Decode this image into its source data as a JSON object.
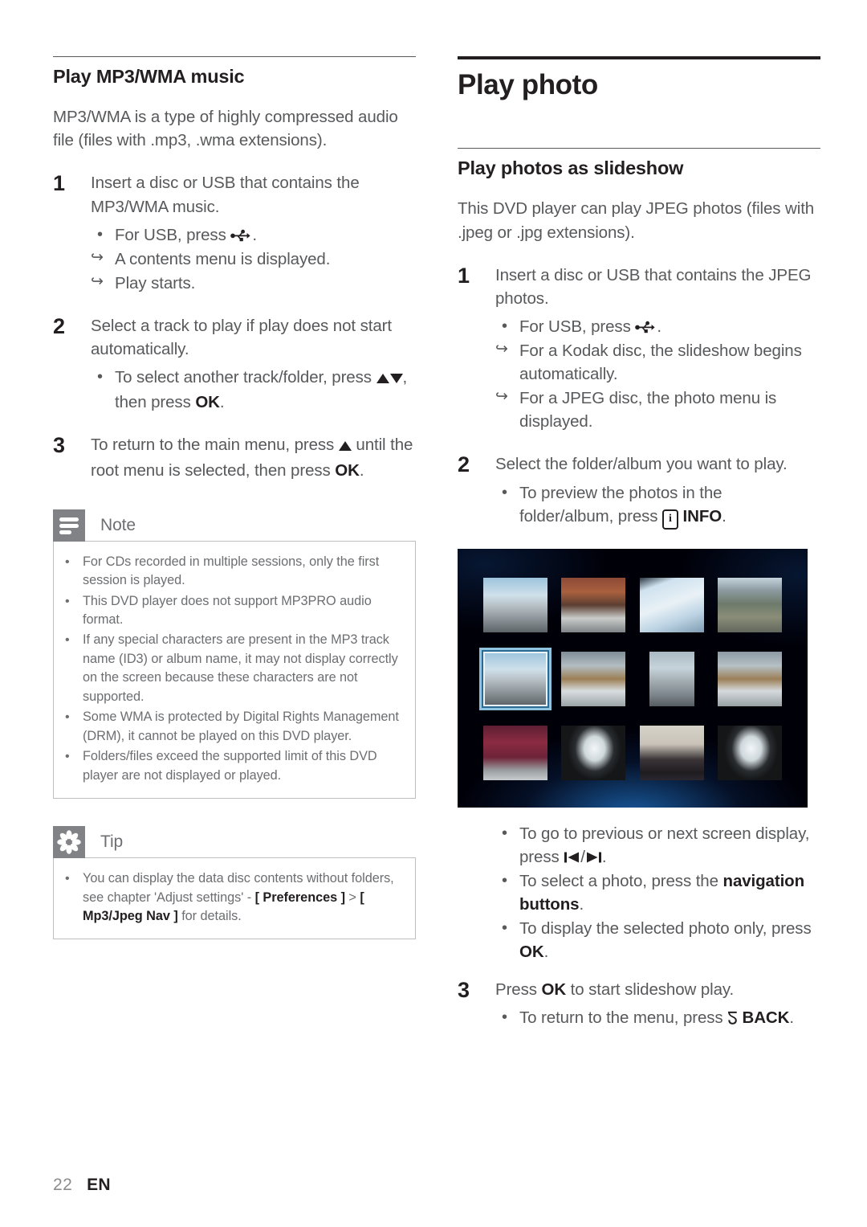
{
  "page": {
    "number": "22",
    "language": "EN"
  },
  "left_column": {
    "section_title": "Play MP3/WMA music",
    "intro": "MP3/WMA is a type of highly compressed audio file (files with .mp3, .wma extensions).",
    "steps": [
      {
        "number": "1",
        "text": "Insert a disc or USB that contains the MP3/WMA music.",
        "sub": [
          {
            "mark": "bullet",
            "text_before": "For USB, press ",
            "icon": "usb-icon",
            "text_after": "."
          },
          {
            "mark": "arrow",
            "text_before": "A contents menu is displayed.",
            "icon": "",
            "text_after": ""
          },
          {
            "mark": "arrow",
            "text_before": "Play starts.",
            "icon": "",
            "text_after": ""
          }
        ]
      },
      {
        "number": "2",
        "text": "Select a track to play if play does not start automatically.",
        "sub": [
          {
            "mark": "bullet",
            "text_before": "To select another track/folder, press ",
            "icon": "up-down-arrows-icon",
            "text_after": ",  then press ",
            "bold_after": "OK",
            "text_end": "."
          }
        ]
      },
      {
        "number": "3",
        "text_parts": {
          "a": "To return to the main menu, press ",
          "icon": "up-arrow-icon",
          "b": " until the root menu is selected, then press ",
          "bold": "OK",
          "c": "."
        }
      }
    ],
    "note": {
      "title": "Note",
      "icon": "note-lines-icon",
      "items": [
        "For CDs recorded in multiple sessions, only the first session is played.",
        "This DVD player does not support MP3PRO audio format.",
        "If any special characters are present in the MP3 track name (ID3) or album name, it may not display correctly on the screen because these characters are not supported.",
        "Some WMA is protected by Digital Rights Management (DRM), it cannot be played on this DVD player.",
        "Folders/files exceed the supported limit of this DVD player are not displayed or played."
      ]
    },
    "tip": {
      "title": "Tip",
      "icon": "tip-asterisk-icon",
      "item": {
        "part1": "You can display the data disc contents without folders, see chapter 'Adjust settings' - ",
        "bold1": "[ Preferences ]",
        "part2": " > ",
        "bold2": "[ Mp3/Jpeg Nav ]",
        "part3": " for details."
      }
    }
  },
  "right_column": {
    "chapter_title": "Play photo",
    "section_title": "Play photos as slideshow",
    "intro": "This DVD player can play JPEG photos (files with .jpeg or .jpg extensions).",
    "steps": [
      {
        "number": "1",
        "text": "Insert a disc or USB that contains the JPEG photos.",
        "sub": [
          {
            "mark": "bullet",
            "text_before": "For USB, press ",
            "icon": "usb-icon",
            "text_after": "."
          },
          {
            "mark": "arrow",
            "text_before": "For a Kodak disc, the slideshow begins automatically.",
            "icon": "",
            "text_after": ""
          },
          {
            "mark": "arrow",
            "text_before": "For a JPEG disc, the photo menu is displayed.",
            "icon": "",
            "text_after": ""
          }
        ]
      },
      {
        "number": "2",
        "text": "Select the folder/album you want to play.",
        "sub": [
          {
            "mark": "bullet",
            "text_before": "To preview the photos in the folder/album, press ",
            "icon": "info-icon",
            "bold_after": "INFO",
            "text_end": "."
          }
        ]
      },
      {
        "number": "3",
        "text_parts": {
          "a": "Press ",
          "bold": "OK",
          "b": " to start slideshow play."
        },
        "sub": [
          {
            "mark": "bullet",
            "text_before": "To return to the menu, press ",
            "icon": "back-icon",
            "bold_after": "BACK",
            "text_end": "."
          }
        ]
      }
    ],
    "figure_bullets": [
      {
        "part1": "To go to previous or next screen display, press ",
        "icon1": "previous-track-icon",
        "sep": "/",
        "icon2": "next-track-icon",
        "part2": "."
      },
      {
        "part1": "To select a photo, press the ",
        "bold": "navigation buttons",
        "part2": "."
      },
      {
        "part1": "To display the selected photo only, press ",
        "bold": "OK",
        "part2": "."
      }
    ],
    "figure": {
      "name": "photo-thumbnail-grid-screenshot",
      "rows": 3,
      "columns": 4,
      "selected_index": 4,
      "thumbnails": [
        {
          "label": "snowy-street-trees"
        },
        {
          "label": "snowy-building-facade"
        },
        {
          "label": "documents-and-pen"
        },
        {
          "label": "aerial-town-view"
        },
        {
          "label": "snowy-street-trees-selected"
        },
        {
          "label": "snowy-parked-car"
        },
        {
          "label": "bicycle-in-snow"
        },
        {
          "label": "snowy-parked-car-2"
        },
        {
          "label": "red-brick-building"
        },
        {
          "label": "bright-window-interior"
        },
        {
          "label": "people-at-gathering"
        },
        {
          "label": "bright-window-interior-2"
        }
      ]
    }
  },
  "colors": {
    "heading": "#231f20",
    "body": "#58595b",
    "callout_icon_bg": "#808285",
    "callout_border": "#bcbec0",
    "selection_highlight": "#8fc3e0"
  }
}
